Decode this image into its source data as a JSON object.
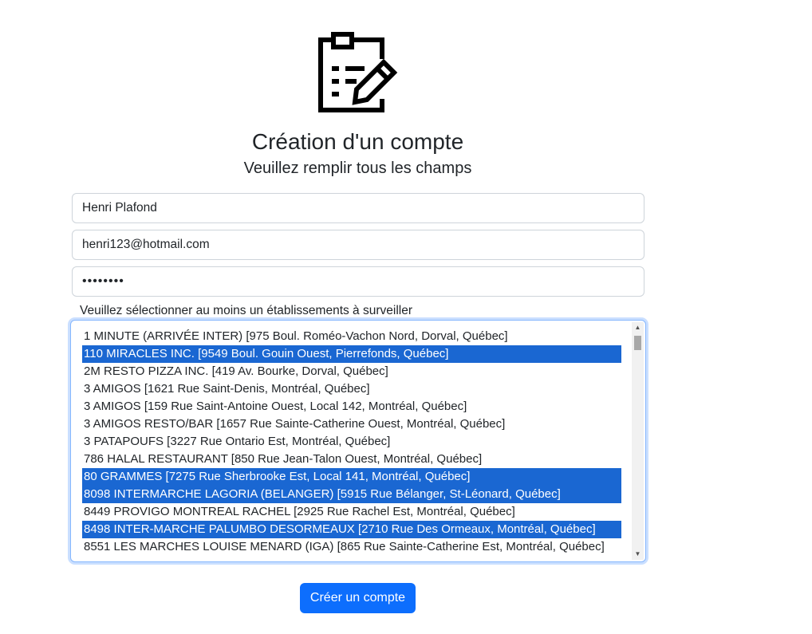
{
  "header": {
    "icon": "clipboard-edit-icon",
    "title": "Création d'un compte",
    "subtitle": "Veuillez remplir tous les champs"
  },
  "form": {
    "name_value": "Henri Plafond",
    "email_value": "henri123@hotmail.com",
    "password_value": "••••••••",
    "establishments_label": "Veuillez sélectionner au moins un établissements à surveiller",
    "options": [
      {
        "label": "1 MINUTE (ARRIVÉE INTER) [975 Boul. Roméo-Vachon Nord, Dorval, Québec]",
        "selected": false
      },
      {
        "label": "110 MIRACLES INC. [9549 Boul. Gouin Ouest, Pierrefonds, Québec]",
        "selected": true
      },
      {
        "label": "2M RESTO PIZZA INC. [419 Av. Bourke, Dorval, Québec]",
        "selected": false
      },
      {
        "label": "3 AMIGOS [1621 Rue Saint-Denis, Montréal, Québec]",
        "selected": false
      },
      {
        "label": "3 AMIGOS [159 Rue Saint-Antoine Ouest, Local 142, Montréal, Québec]",
        "selected": false
      },
      {
        "label": "3 AMIGOS RESTO/BAR [1657 Rue Sainte-Catherine Ouest, Montréal, Québec]",
        "selected": false
      },
      {
        "label": "3 PATAPOUFS [3227 Rue Ontario Est, Montréal, Québec]",
        "selected": false
      },
      {
        "label": "786 HALAL RESTAURANT [850 Rue Jean-Talon Ouest, Montréal, Québec]",
        "selected": false
      },
      {
        "label": "80 GRAMMES [7275 Rue Sherbrooke Est, Local 141, Montréal, Québec]",
        "selected": true
      },
      {
        "label": "8098 INTERMARCHE LAGORIA (BELANGER) [5915 Rue Bélanger, St-Léonard, Québec]",
        "selected": true
      },
      {
        "label": "8449 PROVIGO MONTREAL RACHEL [2925 Rue Rachel Est, Montréal, Québec]",
        "selected": false
      },
      {
        "label": "8498 INTER-MARCHE PALUMBO DESORMEAUX [2710 Rue Des Ormeaux, Montréal, Québec]",
        "selected": true
      },
      {
        "label": "8551 LES MARCHES LOUISE MENARD (IGA) [865 Rue Sainte-Catherine Est, Montréal, Québec]",
        "selected": false
      }
    ]
  },
  "submit_label": "Créer un compte",
  "colors": {
    "primary": "#0d6efd",
    "selected_option_bg": "#1a67d2",
    "focus_border": "#86b7fe"
  }
}
